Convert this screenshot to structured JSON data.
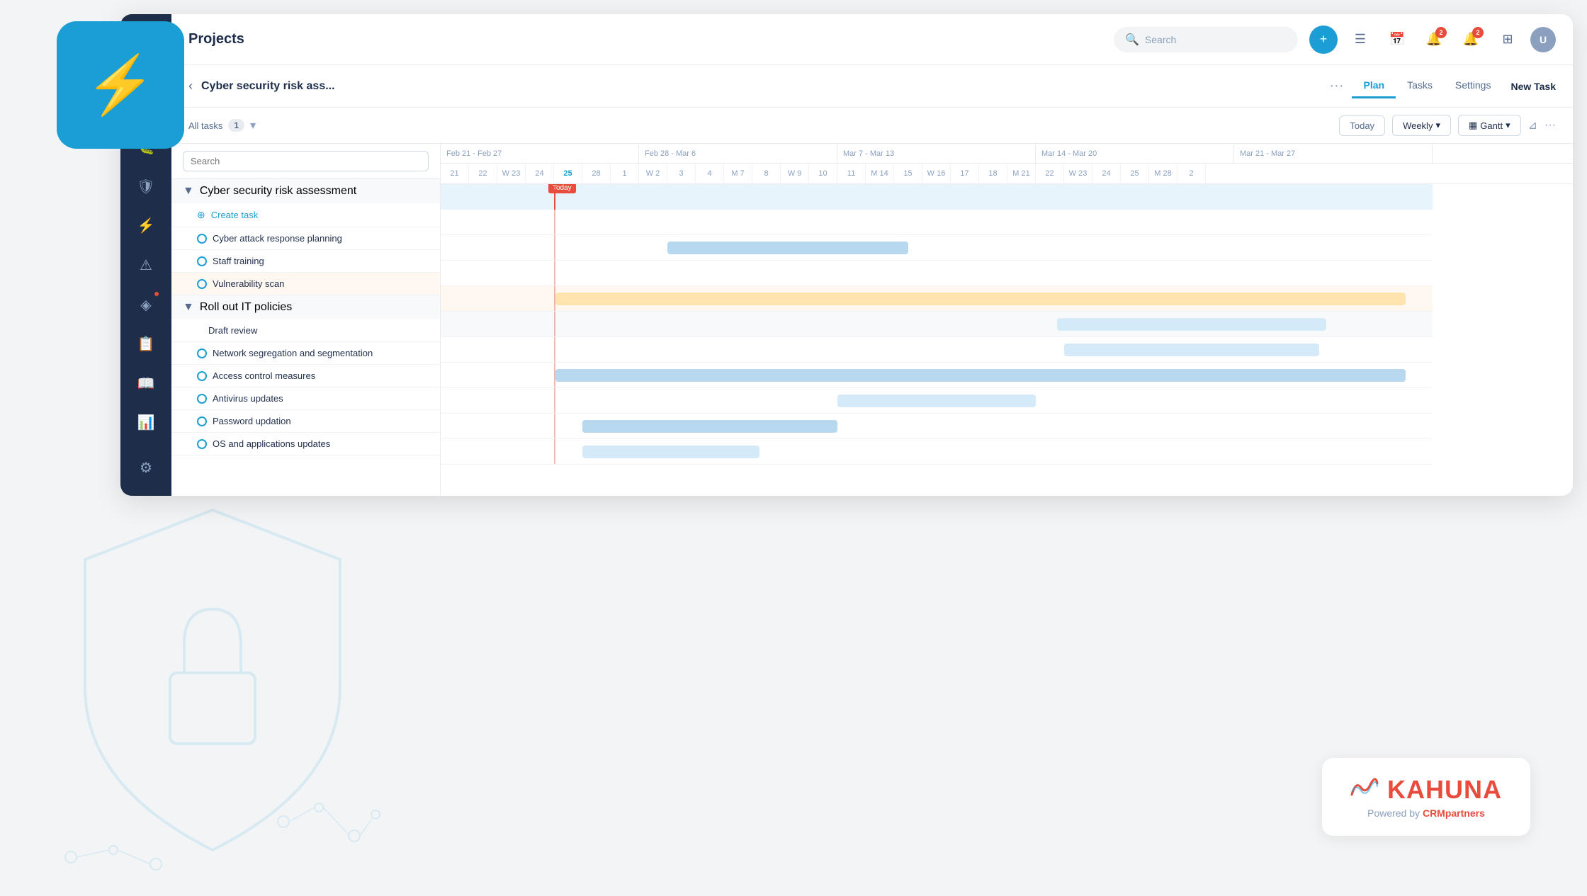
{
  "app": {
    "title": "Projects",
    "logo_alt": "bolt-icon"
  },
  "header": {
    "search_placeholder": "Search",
    "search_text": "Search",
    "add_label": "+",
    "notifications_count_1": "2",
    "notifications_count_2": "2"
  },
  "project": {
    "title": "Cyber security risk ass...",
    "tabs": [
      "Plan",
      "Tasks",
      "Settings"
    ],
    "active_tab": "Plan",
    "new_task_label": "New Task"
  },
  "toolbar": {
    "all_tasks_label": "All tasks",
    "task_count": "1",
    "today_label": "Today",
    "weekly_label": "Weekly",
    "gantt_label": "Gantt",
    "filter_label": "⊿"
  },
  "task_search": {
    "placeholder": "Search"
  },
  "task_groups": [
    {
      "name": "Cyber security risk assessment",
      "expanded": true,
      "tasks": [
        {
          "name": "Create task",
          "type": "create"
        },
        {
          "name": "Cyber attack response planning",
          "type": "task"
        },
        {
          "name": "Staff training",
          "type": "task"
        },
        {
          "name": "Vulnerability scan",
          "type": "task",
          "highlighted": true
        }
      ]
    },
    {
      "name": "Roll out IT policies",
      "expanded": true,
      "tasks": [
        {
          "name": "Draft review",
          "type": "task",
          "sub": true
        },
        {
          "name": "Network segregation and segmentation",
          "type": "task"
        },
        {
          "name": "Access control measures",
          "type": "task"
        },
        {
          "name": "Antivirus updates",
          "type": "task"
        },
        {
          "name": "Password updation",
          "type": "task"
        },
        {
          "name": "OS and applications updates",
          "type": "task"
        }
      ]
    }
  ],
  "gantt": {
    "weeks": [
      {
        "label": "Feb 21 - Feb 27",
        "days": 7
      },
      {
        "label": "Feb 28 - Mar 6",
        "days": 7
      },
      {
        "label": "Mar 7 - Mar 13",
        "days": 7
      },
      {
        "label": "Mar 14 - Mar 20",
        "days": 7
      },
      {
        "label": "Mar 21 - Mar 27",
        "days": 7
      }
    ],
    "day_labels": [
      "21",
      "22",
      "W 23",
      "24",
      "25",
      "28",
      "1",
      "W 2",
      "3",
      "4",
      "M 7",
      "8",
      "W 9",
      "10",
      "11",
      "M 14",
      "15",
      "W 16",
      "17",
      "18",
      "M 21",
      "22",
      "W 23",
      "24",
      "25",
      "M 28",
      "2"
    ],
    "today_label": "Today",
    "today_col": 4
  },
  "sidebar": {
    "items": [
      {
        "icon": "⊙",
        "label": "home",
        "active": false
      },
      {
        "icon": "☰",
        "label": "messages",
        "active": false
      },
      {
        "icon": "🐛",
        "label": "bugs",
        "active": false
      },
      {
        "icon": "🛡",
        "label": "shield",
        "active": false
      },
      {
        "icon": "⚡",
        "label": "lightning",
        "active": false
      },
      {
        "icon": "⚠",
        "label": "warning",
        "active": false
      },
      {
        "icon": "◈",
        "label": "layers",
        "active": false
      },
      {
        "icon": "📋",
        "label": "reports",
        "active": false
      },
      {
        "icon": "📖",
        "label": "docs",
        "active": false
      },
      {
        "icon": "📊",
        "label": "analytics",
        "active": false
      },
      {
        "icon": "⚙",
        "label": "settings",
        "active": false
      }
    ]
  },
  "kahuna": {
    "name": "KAHUNA",
    "tagline": "Powered by CRMpartners"
  }
}
